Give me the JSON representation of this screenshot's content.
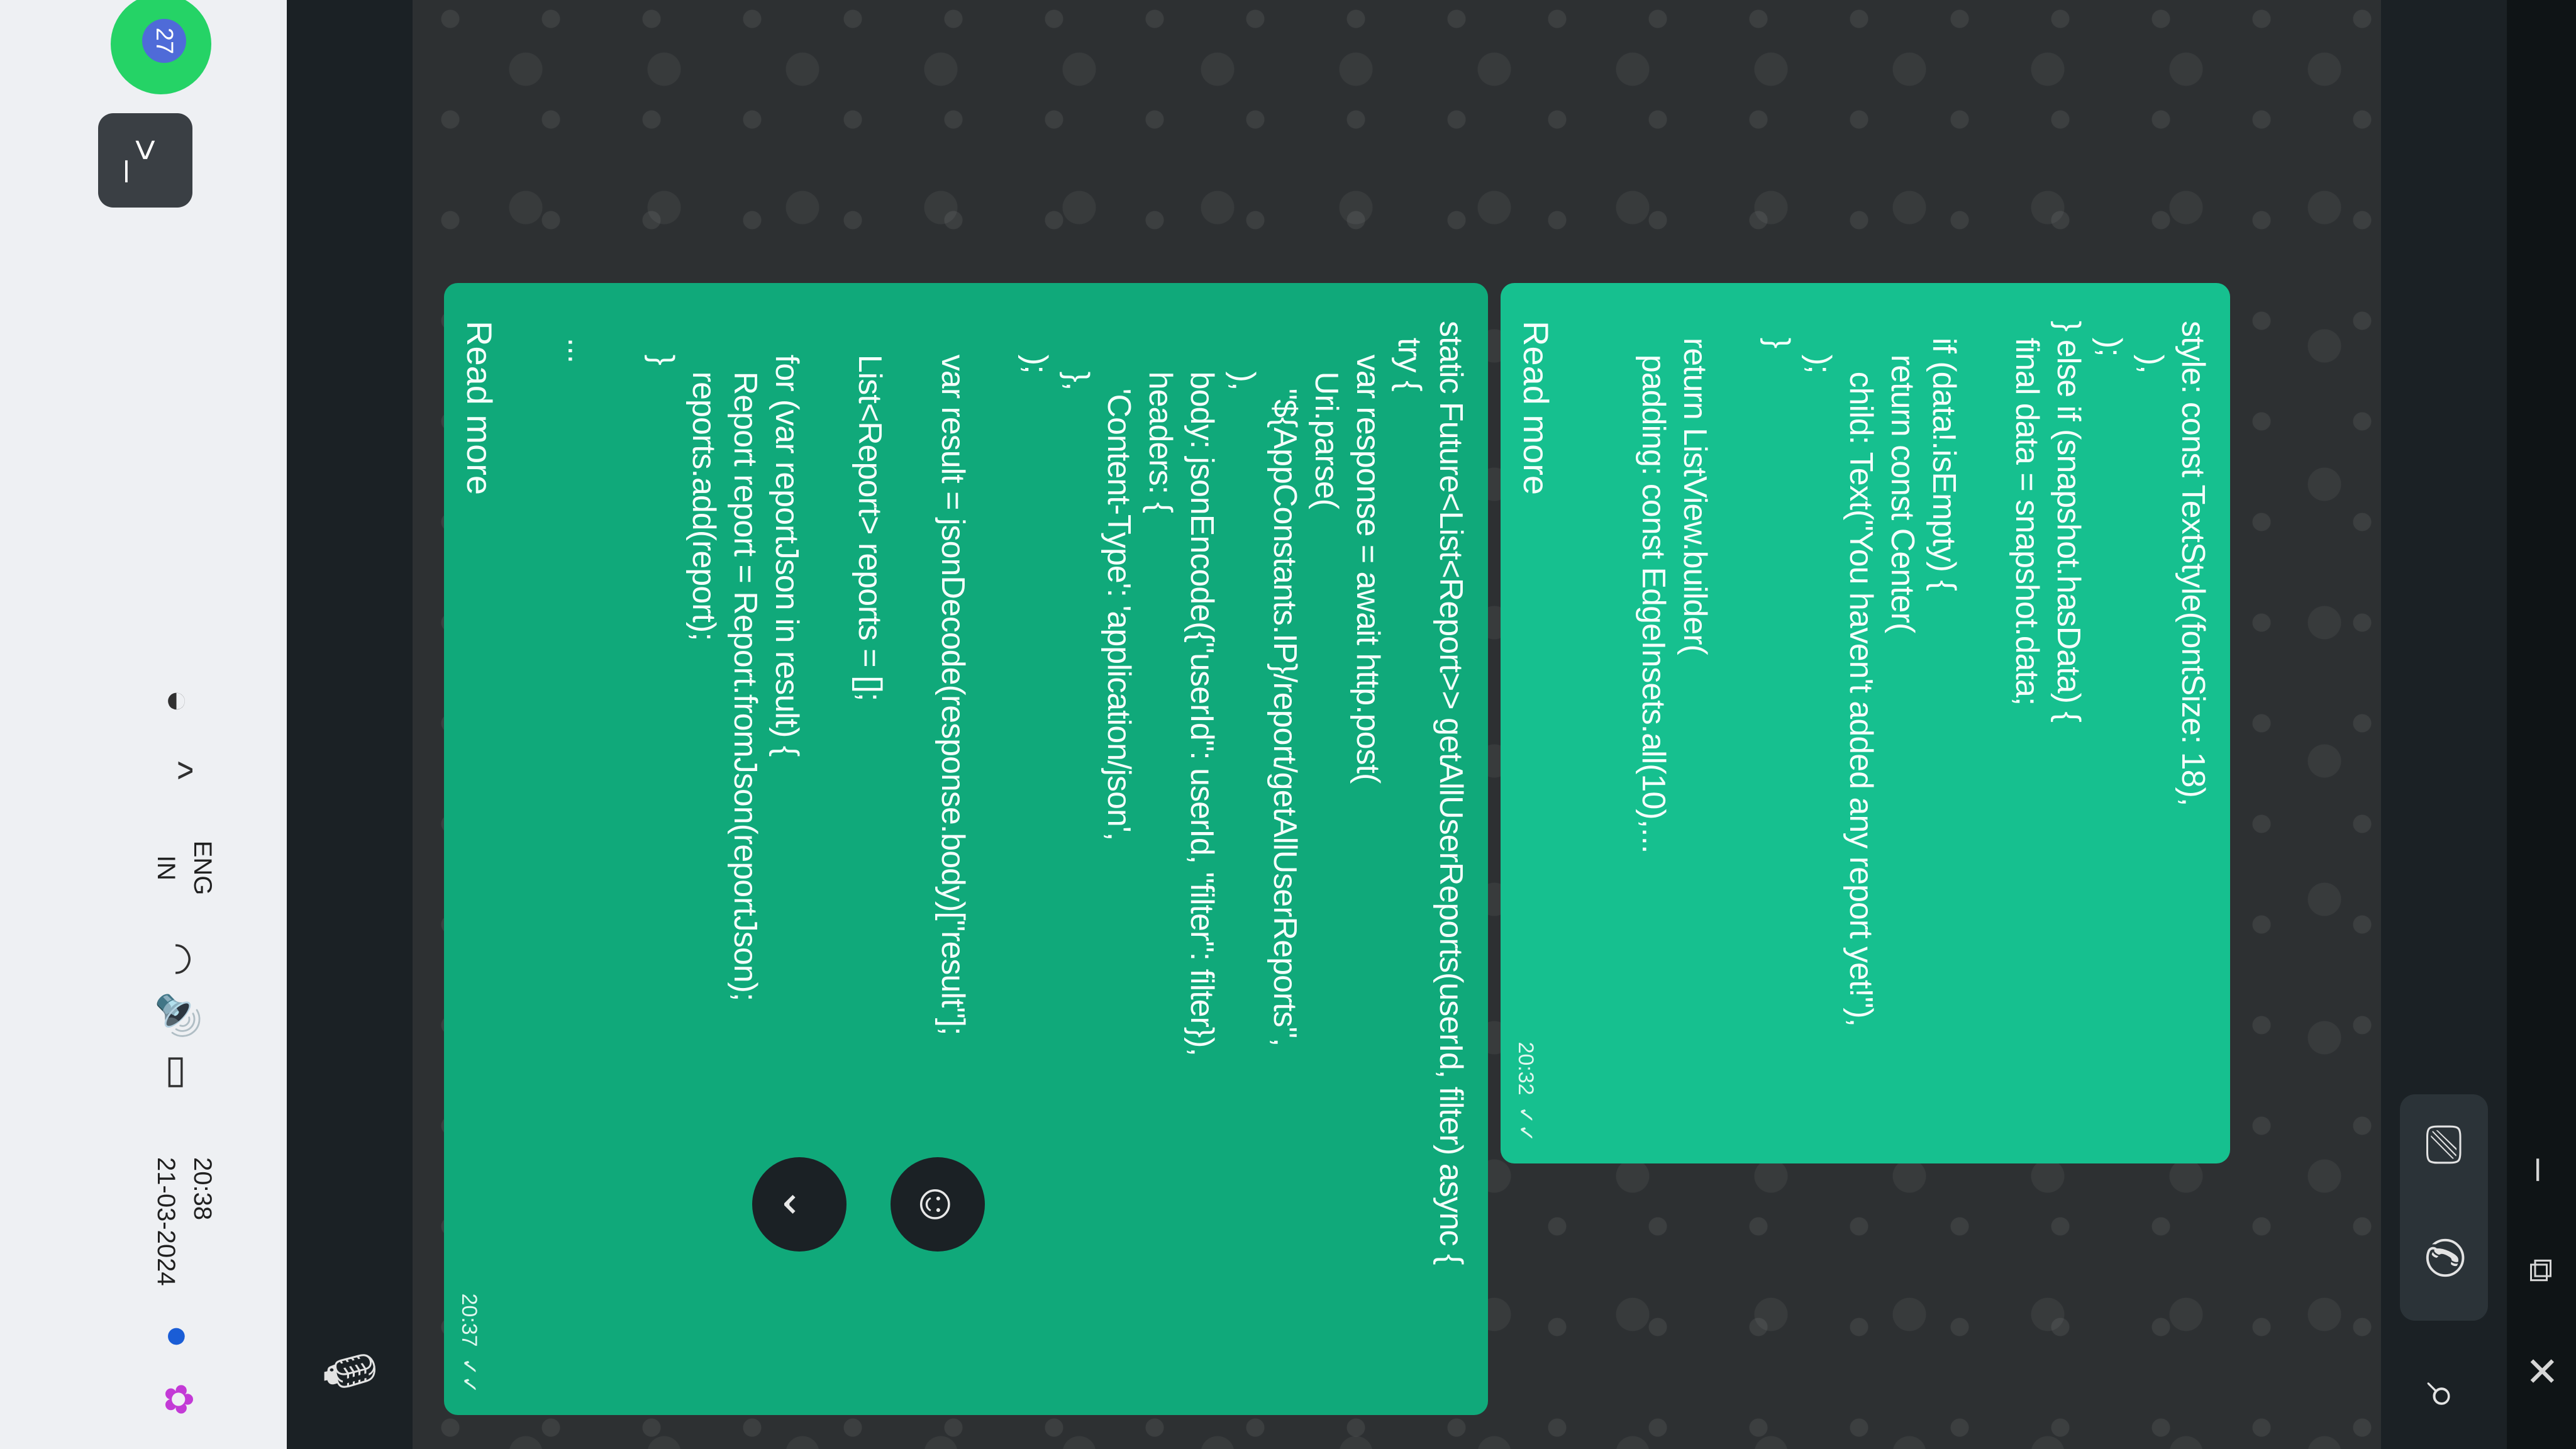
{
  "window": {
    "minimize": "–",
    "maximize": "⧉",
    "close": "✕"
  },
  "header": {
    "video_icon": "⎚",
    "call_icon": "✆",
    "search_icon": "⌕"
  },
  "messages": [
    {
      "code": "style: const TextStyle(fontSize: 18),\n    ),\n  );\n} else if (snapshot.hasData) {\n  final data = snapshot.data;\n\n  if (data!.isEmpty) {\n    return const Center(\n      child: Text(\"You haven't added any report yet!\"),\n    );\n  }\n\n  return ListView.builder(\n    padding: const EdgeInsets.all(10),...",
      "read_more": "Read more",
      "time": "20:32",
      "ticks": "✓✓"
    },
    {
      "code": "static Future<List<Report>> getAllUserReports(userId, filter) async {\n  try {\n    var response = await http.post(\n      Uri.parse(\n        \"${AppConstants.IP}/report/getAllUserReports\",\n      ),\n      body: jsonEncode({\"userId\": userId, \"filter\": filter}),\n      headers: {\n        'Content-Type': 'application/json',\n      },\n    );\n\n    var result = jsonDecode(response.body)[\"result\"];\n\n    List<Report> reports = [];\n\n    for (var reportJson in result) {\n      Report report = Report.fromJson(reportJson);\n      reports.add(report);\n    }\n\n  ...",
      "read_more": "Read more",
      "time": "20:37",
      "ticks": "✓✓"
    }
  ],
  "controls": {
    "scroll_down": "⌄",
    "emoji": "☺",
    "mic": "🎙"
  },
  "taskbar": {
    "time": "20:38",
    "date": "21-03-2024",
    "language": "ENG",
    "region": "IN",
    "chevron": "^",
    "shield": "◒",
    "wifi": "◠",
    "volume": "🔊",
    "battery": "▭",
    "notify": "●",
    "copilot": "✿",
    "terminal_glyph": ">_",
    "whatsapp_glyph": "✆",
    "whatsapp_badge": "27"
  },
  "colors": {
    "bubble_primary": "#16c08f",
    "bubble_secondary": "#10a97a",
    "chat_background": "#2d3032",
    "taskbar": "#eef0f3"
  }
}
